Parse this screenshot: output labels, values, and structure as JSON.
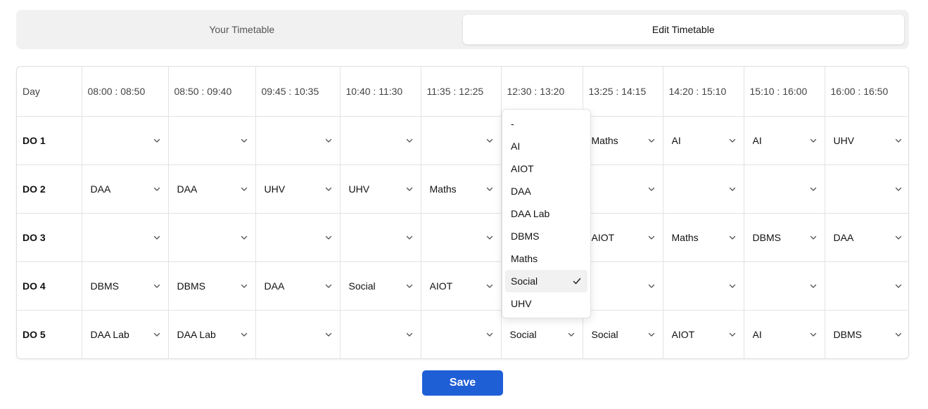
{
  "tabs": [
    {
      "label": "Your Timetable",
      "active": false
    },
    {
      "label": "Edit Timetable",
      "active": true
    }
  ],
  "table": {
    "day_header": "Day",
    "time_slots": [
      "08:00 : 08:50",
      "08:50 : 09:40",
      "09:45 : 10:35",
      "10:40 : 11:30",
      "11:35 : 12:25",
      "12:30 : 13:20",
      "13:25 : 14:15",
      "14:20 : 15:10",
      "15:10 : 16:00",
      "16:00 : 16:50"
    ],
    "rows": [
      {
        "day": "DO 1",
        "cells": [
          "",
          "",
          "",
          "",
          "",
          "",
          "Maths",
          "AI",
          "AI",
          "UHV"
        ]
      },
      {
        "day": "DO 2",
        "cells": [
          "DAA",
          "DAA",
          "UHV",
          "UHV",
          "Maths",
          "",
          "",
          "",
          "",
          ""
        ]
      },
      {
        "day": "DO 3",
        "cells": [
          "",
          "",
          "",
          "",
          "",
          "",
          "AIOT",
          "Maths",
          "DBMS",
          "DAA"
        ]
      },
      {
        "day": "DO 4",
        "cells": [
          "DBMS",
          "DBMS",
          "DAA",
          "Social",
          "AIOT",
          "",
          "",
          "",
          "",
          ""
        ]
      },
      {
        "day": "DO 5",
        "cells": [
          "DAA Lab",
          "DAA Lab",
          "",
          "",
          "",
          "Social",
          "Social",
          "AIOT",
          "AI",
          "DBMS"
        ]
      }
    ]
  },
  "dropdown": {
    "open_for": {
      "day": "DO 4",
      "slot": "12:30 : 13:20"
    },
    "options": [
      "-",
      "AI",
      "AIOT",
      "DAA",
      "DAA Lab",
      "DBMS",
      "Maths",
      "Social",
      "UHV"
    ],
    "selected": "Social"
  },
  "save_label": "Save",
  "colors": {
    "primary": "#1f5fd6",
    "tab_bar": "#f1f1f1",
    "border": "#e3e3e3",
    "selected_option_bg": "#f1f1f1"
  },
  "icons": {
    "select_indicator": "chevron-down-icon",
    "selected_marker": "check-icon"
  }
}
